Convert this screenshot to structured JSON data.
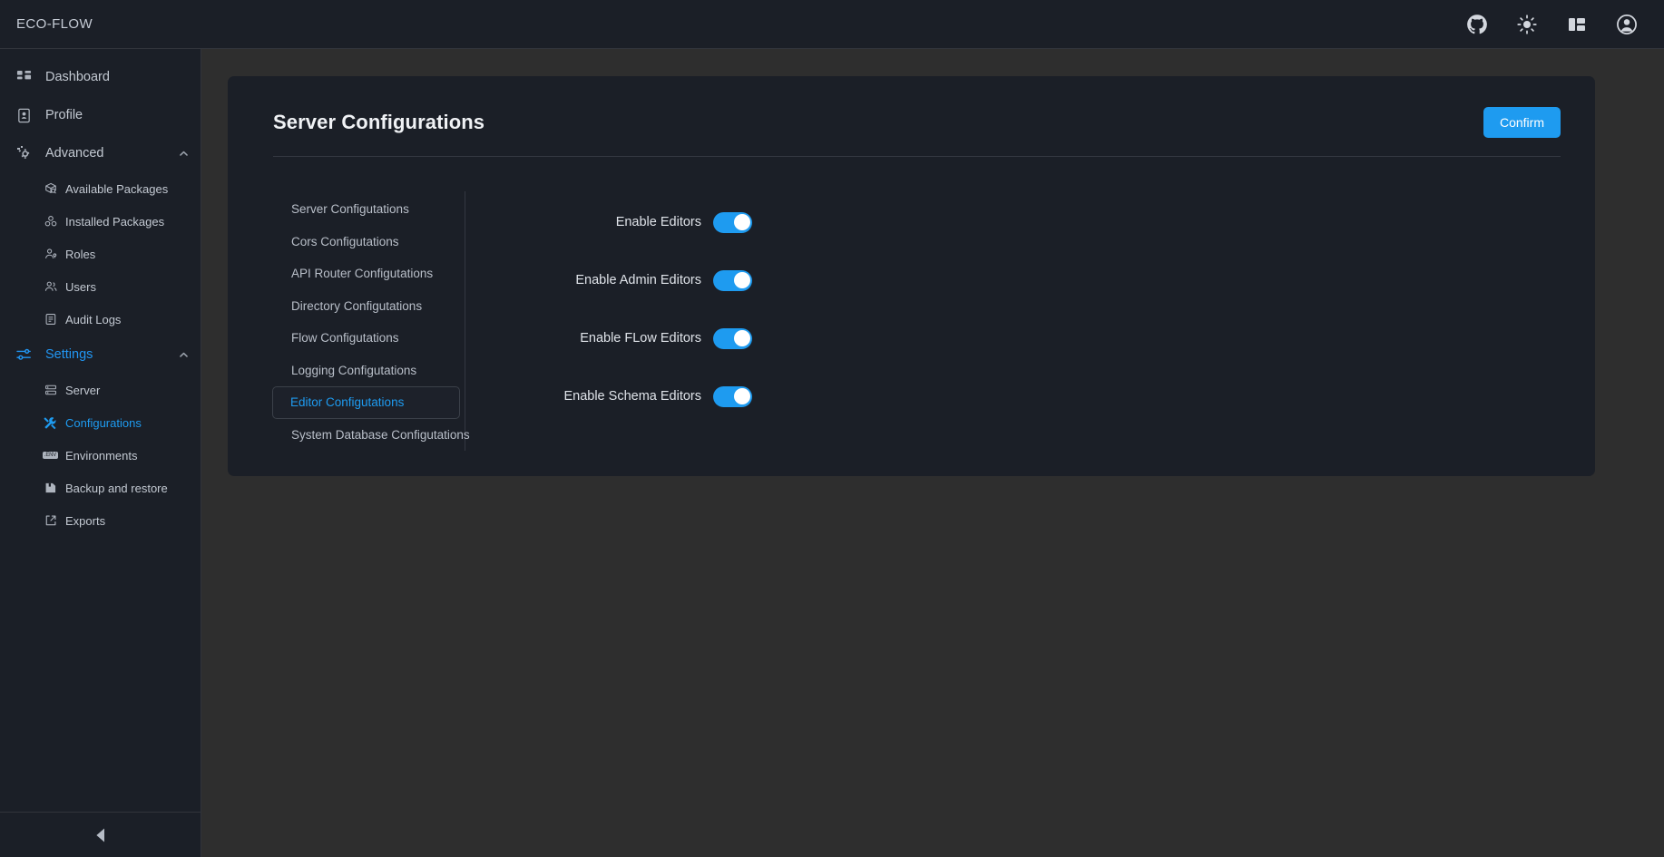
{
  "app": {
    "brand": "ECO-FLOW"
  },
  "header": {
    "icons": [
      {
        "name": "github-icon",
        "label": "GitHub"
      },
      {
        "name": "sun-icon",
        "label": "Toggle light mode"
      },
      {
        "name": "layout-panel-icon",
        "label": "Toggle panel"
      },
      {
        "name": "account-circle-icon",
        "label": "Account"
      }
    ]
  },
  "sidebar": {
    "items": [
      {
        "label": "Dashboard",
        "icon": "dashboard-grid-icon",
        "level": "top",
        "active": false,
        "expandable": false
      },
      {
        "label": "Profile",
        "icon": "profile-card-icon",
        "level": "top",
        "active": false,
        "expandable": false
      },
      {
        "label": "Advanced",
        "icon": "advanced-gear-icon",
        "level": "top",
        "active": false,
        "expandable": true,
        "expanded": true
      },
      {
        "label": "Available Packages",
        "icon": "package-search-icon",
        "level": "sub",
        "active": false
      },
      {
        "label": "Installed Packages",
        "icon": "packages-stack-icon",
        "level": "sub",
        "active": false
      },
      {
        "label": "Roles",
        "icon": "role-person-icon",
        "level": "sub",
        "active": false
      },
      {
        "label": "Users",
        "icon": "users-group-icon",
        "level": "sub",
        "active": false
      },
      {
        "label": "Audit Logs",
        "icon": "audit-log-icon",
        "level": "sub",
        "active": false
      },
      {
        "label": "Settings",
        "icon": "settings-sliders-icon",
        "level": "top",
        "active": true,
        "expandable": true,
        "expanded": true
      },
      {
        "label": "Server",
        "icon": "server-rack-icon",
        "level": "sub",
        "active": false
      },
      {
        "label": "Configurations",
        "icon": "tools-wrench-icon",
        "level": "sub",
        "active": true
      },
      {
        "label": "Environments",
        "icon": "env-file-icon",
        "level": "sub",
        "active": false,
        "badge_text": ".ENV"
      },
      {
        "label": "Backup and restore",
        "icon": "backup-drive-icon",
        "level": "sub",
        "active": false
      },
      {
        "label": "Exports",
        "icon": "export-share-icon",
        "level": "sub",
        "active": false
      }
    ],
    "collapse_icon": "collapse-left-triangle-icon"
  },
  "page": {
    "title": "Server Configurations",
    "confirm_label": "Confirm"
  },
  "tabs": [
    {
      "label": "Server Configutations",
      "active": false
    },
    {
      "label": "Cors Configutations",
      "active": false
    },
    {
      "label": "API Router Configutations",
      "active": false
    },
    {
      "label": "Directory Configutations",
      "active": false
    },
    {
      "label": "Flow Configutations",
      "active": false
    },
    {
      "label": "Logging Configutations",
      "active": false
    },
    {
      "label": "Editor Configutations",
      "active": true
    },
    {
      "label": "System Database Configutations",
      "active": false
    }
  ],
  "settings": [
    {
      "label": "Enable Editors",
      "value": true
    },
    {
      "label": "Enable Admin Editors",
      "value": true
    },
    {
      "label": "Enable FLow Editors",
      "value": true
    },
    {
      "label": "Enable Schema Editors",
      "value": true
    }
  ],
  "colors": {
    "accent": "#1e9bf0",
    "panel": "#1b1f27",
    "canvas": "#2e2e2e",
    "border": "#343841",
    "text": "#c3c9d2"
  }
}
